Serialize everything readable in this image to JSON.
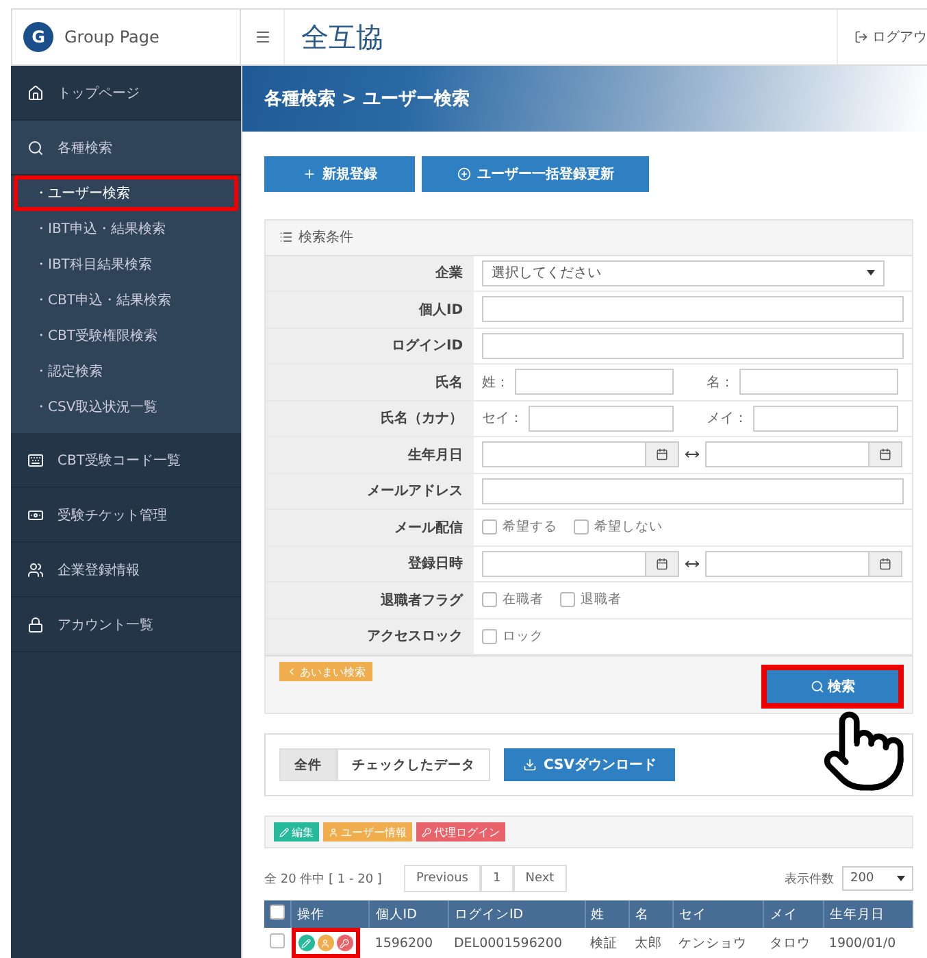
{
  "brand": {
    "logo_letter": "G",
    "name": "Group Page"
  },
  "header": {
    "title": "全互協",
    "logout": "ログアウ"
  },
  "sidebar": {
    "items": [
      {
        "label": "トップページ",
        "selected": false
      },
      {
        "label": "各種検索",
        "selected": false,
        "expanded": true,
        "children": [
          {
            "label": "・ユーザー検索",
            "selected": true,
            "highlighted": true
          },
          {
            "label": "・IBT申込・結果検索",
            "selected": false,
            "highlighted": false
          },
          {
            "label": "・IBT科目結果検索",
            "selected": false,
            "highlighted": false
          },
          {
            "label": "・CBT申込・結果検索",
            "selected": false,
            "highlighted": false
          },
          {
            "label": "・CBT受験権限検索",
            "selected": false,
            "highlighted": false
          },
          {
            "label": "・認定検索",
            "selected": false,
            "highlighted": false
          },
          {
            "label": "・CSV取込状況一覧",
            "selected": false,
            "highlighted": false
          }
        ]
      },
      {
        "label": "CBT受験コード一覧",
        "selected": false
      },
      {
        "label": "受験チケット管理",
        "selected": false
      },
      {
        "label": "企業登録情報",
        "selected": false
      },
      {
        "label": "アカウント一覧",
        "selected": false
      }
    ]
  },
  "breadcrumb": "各種検索 > ユーザー検索",
  "action_buttons": [
    "新規登録",
    "ユーザー一括登録更新"
  ],
  "search_panel": {
    "title": "検索条件",
    "rows": [
      {
        "kind": "select",
        "label": "企業",
        "value": "選択してください"
      },
      {
        "kind": "text",
        "label": "個人ID"
      },
      {
        "kind": "text",
        "label": "ログインID"
      },
      {
        "kind": "pair",
        "label": "氏名",
        "prefixes": [
          "姓：",
          "名："
        ]
      },
      {
        "kind": "pair",
        "label": "氏名（カナ）",
        "prefixes": [
          "セイ：",
          "メイ："
        ]
      },
      {
        "kind": "date_range",
        "label": "生年月日"
      },
      {
        "kind": "text",
        "label": "メールアドレス"
      },
      {
        "kind": "checks",
        "label": "メール配信",
        "options": [
          {
            "label": "希望する",
            "checked": false
          },
          {
            "label": "希望しない",
            "checked": false
          }
        ]
      },
      {
        "kind": "date_range",
        "label": "登録日時"
      },
      {
        "kind": "checks",
        "label": "退職者フラグ",
        "options": [
          {
            "label": "在職者",
            "checked": false
          },
          {
            "label": "退職者",
            "checked": false
          }
        ]
      },
      {
        "kind": "checks",
        "label": "アクセスロック",
        "options": [
          {
            "label": "ロック",
            "checked": false
          }
        ]
      }
    ],
    "fuzzy_button": "あいまい検索",
    "search_button": {
      "label": "検索",
      "highlighted": true
    }
  },
  "export": {
    "tabs": [
      {
        "label": "全件",
        "selected": true
      },
      {
        "label": "チェックしたデータ",
        "selected": false
      }
    ],
    "csv_button": "CSVダウンロード"
  },
  "legend": [
    {
      "label": "編集",
      "color": "#26b99a"
    },
    {
      "label": "ユーザー情報",
      "color": "#f0ad4e"
    },
    {
      "label": "代理ログイン",
      "color": "#e9646a"
    }
  ],
  "pager": {
    "summary": "全 20 件中 [ 1 - 20 ]",
    "buttons": [
      "Previous",
      "1",
      "Next"
    ],
    "per_page_label": "表示件数",
    "per_page": "200"
  },
  "table": {
    "header_checked": false,
    "columns": [
      "操作",
      "個人ID",
      "ログインID",
      "姓",
      "名",
      "セイ",
      "メイ",
      "生年月日"
    ],
    "rows": [
      {
        "checked": false,
        "edit_highlighted": true,
        "cells": [
          "",
          "1596200",
          "DEL0001596200",
          "検証",
          "太郎",
          "ケンショウ",
          "タロウ",
          "1900/01/0"
        ]
      }
    ]
  }
}
